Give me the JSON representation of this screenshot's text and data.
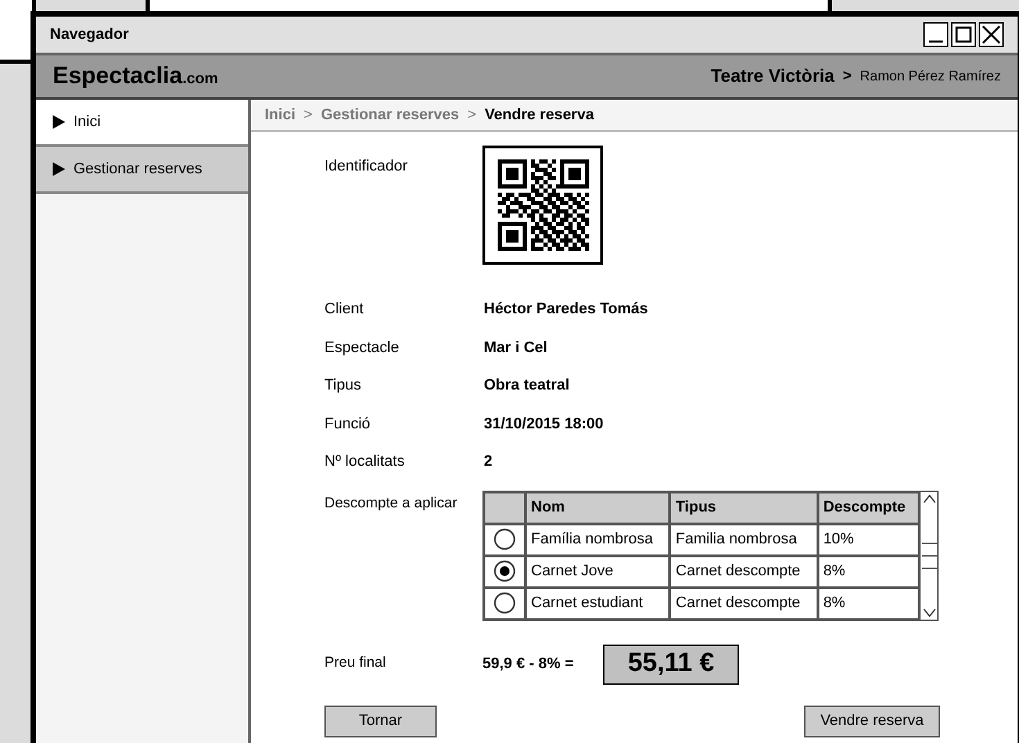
{
  "window": {
    "title": "Navegador"
  },
  "header": {
    "brand": "Espectaclia",
    "brand_suffix": ".com",
    "venue": "Teatre Victòria",
    "separator": ">",
    "user": "Ramon Pérez Ramírez"
  },
  "sidebar": {
    "items": [
      {
        "label": "Inici",
        "selected": false
      },
      {
        "label": "Gestionar reserves",
        "selected": true
      }
    ]
  },
  "breadcrumb": {
    "separator": ">",
    "items": [
      {
        "label": "Inici",
        "current": false
      },
      {
        "label": "Gestionar reserves",
        "current": false
      },
      {
        "label": "Vendre reserva",
        "current": true
      }
    ]
  },
  "fields": [
    {
      "kind": "qr",
      "label": "Identificador"
    },
    {
      "kind": "text",
      "label": "Client",
      "value": "Héctor Paredes Tomás"
    },
    {
      "kind": "text",
      "label": "Espectacle",
      "value": "Mar i Cel"
    },
    {
      "kind": "text",
      "label": "Tipus",
      "value": "Obra teatral"
    },
    {
      "kind": "text",
      "label": "Funció",
      "value": "31/10/2015 18:00"
    },
    {
      "kind": "text",
      "label": "Nº localitats",
      "value": "2"
    }
  ],
  "discounts": {
    "label": "Descompte a aplicar",
    "columns": [
      "Nom",
      "Tipus",
      "Descompte"
    ],
    "rows": [
      {
        "selected": false,
        "cells": [
          "Família nombrosa",
          "Familia nombrosa",
          "10%"
        ]
      },
      {
        "selected": true,
        "cells": [
          "Carnet Jove",
          "Carnet descompte",
          "8%"
        ]
      },
      {
        "selected": false,
        "cells": [
          "Carnet estudiant",
          "Carnet descompte",
          "8%"
        ]
      }
    ]
  },
  "price": {
    "label": "Preu final",
    "formula": "59,9 € - 8% =",
    "total": "55,11 €"
  },
  "buttons": [
    {
      "label": "Tornar",
      "kind": "back"
    },
    {
      "label": "Vendre reserva",
      "kind": "primary"
    }
  ]
}
